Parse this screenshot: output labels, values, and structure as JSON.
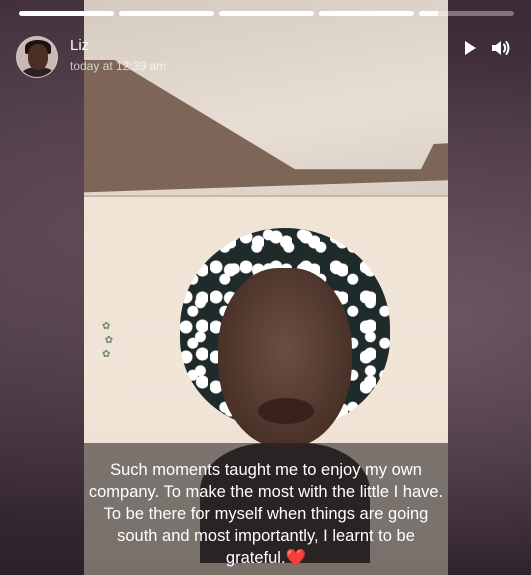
{
  "story": {
    "progress_segments": [
      1,
      1,
      1,
      1,
      0.2
    ]
  },
  "header": {
    "user_name": "Liz",
    "timestamp": "today at 12:39 am",
    "play_icon": "play-icon",
    "volume_icon": "volume-icon"
  },
  "caption": {
    "text": "Such moments taught me to enjoy my own company. To make the most with the little I have. To be there for myself when things are going south and most importantly, I learnt to be grateful.",
    "emoji": "❤️"
  }
}
